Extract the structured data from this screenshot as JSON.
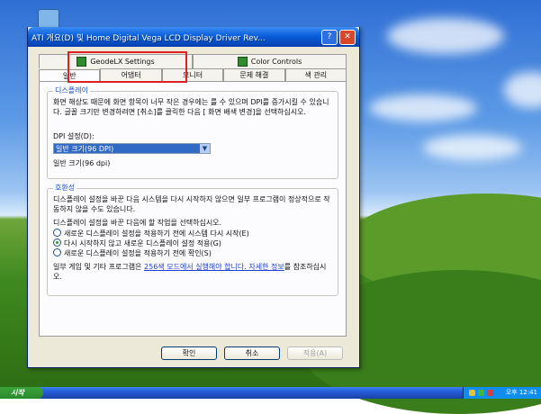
{
  "window": {
    "title": "ATI 개요(D) 및 Home Digital Vega LCD Display Driver Rev... ",
    "help_glyph": "?",
    "close_glyph": "✕"
  },
  "top_tabs": [
    {
      "label": "GeodeLX Settings",
      "icon": "geode-icon"
    },
    {
      "label": "Color Controls",
      "icon": "color-icon"
    }
  ],
  "tabs": [
    "일반",
    "어댑터",
    "모니터",
    "문제 해결",
    "색 관리"
  ],
  "display_group": {
    "title": "디스플레이",
    "desc": "화면 해상도 때문에 화면 항목이 너무 작은 경우에는 를 수 있으며 DPI를 증가시킬 수 있습니다. 글꼴 크기만 변경하려면 [취소]를 클릭한 다음 [ 화면 배색 변경]을 선택하십시오.",
    "dpi_label": "DPI 설정(D):",
    "dpi_value": "일반 크기(96 DPI)",
    "dpi_arrow": "▼",
    "dpi_note": "일반 크기(96 dpi)"
  },
  "compat_group": {
    "title": "호환성",
    "desc": "디스플레이 설정을 바꾼 다음 시스템을 다시 시작하지 않으면 일부 프로그램이 정상적으로 작동하지 않을 수도 있습니다.",
    "question": "디스플레이 설정을 바꾼 다음에 할 작업을 선택하십시오.",
    "options": [
      {
        "label": "새로운 디스플레이 설정을 적용하기 전에 시스템 다시 시작(E)",
        "checked": false
      },
      {
        "label": "다시 시작하지 않고 새로운 디스플레이 설정 적용(G)",
        "checked": true
      },
      {
        "label": "새로운 디스플레이 설정을 적용하기 전에 확인(S)",
        "checked": false
      }
    ],
    "note_prefix": "일부 게임 및 기타 프로그램은 ",
    "note_link": "256색 모드에서 실행해야 합니다. 자세한 정보",
    "note_suffix": "를 참조하십시오."
  },
  "buttons": {
    "ok": "확인",
    "cancel": "취소",
    "apply": "적용(A)"
  },
  "taskbar": {
    "start": "시작",
    "clock": "오후 12:41"
  }
}
